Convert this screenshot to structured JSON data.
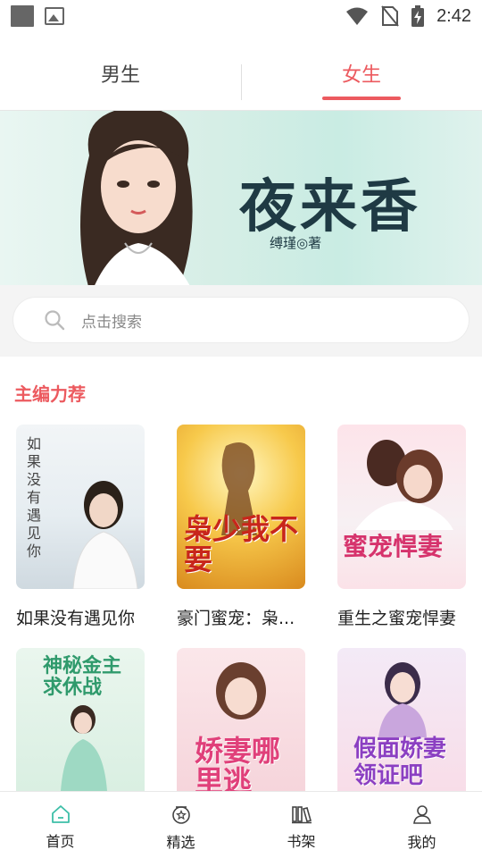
{
  "status_bar": {
    "time": "2:42"
  },
  "tabs": [
    {
      "label": "男生",
      "active": false
    },
    {
      "label": "女生",
      "active": true
    }
  ],
  "banner": {
    "title": "夜来香",
    "author": "缚瑾◎著",
    "dots": 3,
    "active_dot": 2
  },
  "search": {
    "placeholder": "点击搜索"
  },
  "section": {
    "title": "主编力荐",
    "books": [
      {
        "title": "如果没有遇见你",
        "cover_text": "如果没有遇见你"
      },
      {
        "title": "豪门蜜宠：枭...",
        "cover_text": "枭少我不要"
      },
      {
        "title": "重生之蜜宠悍妻",
        "cover_text": "蜜宠悍妻"
      },
      {
        "title": "",
        "cover_text": "神秘金主求休战"
      },
      {
        "title": "",
        "cover_text": "娇妻哪里逃"
      },
      {
        "title": "",
        "cover_text": "假面娇妻领证吧"
      }
    ]
  },
  "bottom_nav": [
    {
      "label": "首页",
      "icon": "home-icon",
      "active": true
    },
    {
      "label": "精选",
      "icon": "star-badge-icon",
      "active": false
    },
    {
      "label": "书架",
      "icon": "bookshelf-icon",
      "active": false
    },
    {
      "label": "我的",
      "icon": "user-icon",
      "active": false
    }
  ],
  "colors": {
    "accent": "#ec5a5f",
    "active_nav": "#3dbfa8",
    "dot_active": "#1a73e8"
  }
}
